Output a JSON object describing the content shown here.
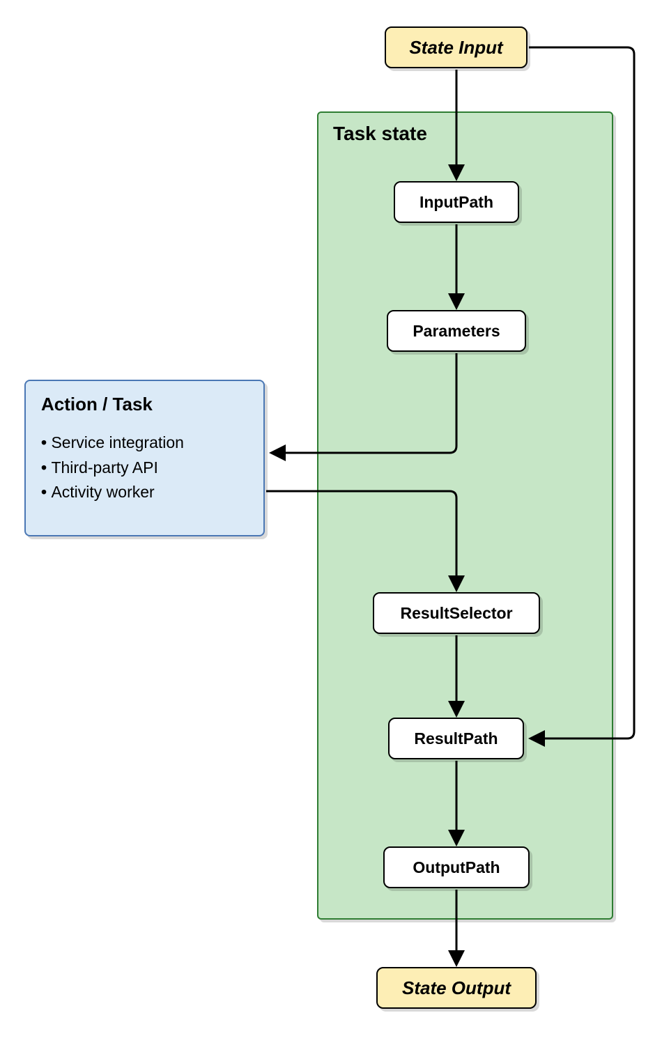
{
  "stateInput": {
    "label": "State Input"
  },
  "stateOutput": {
    "label": "State Output"
  },
  "taskState": {
    "title": "Task state",
    "nodes": {
      "inputPath": "InputPath",
      "parameters": "Parameters",
      "resultSelector": "ResultSelector",
      "resultPath": "ResultPath",
      "outputPath": "OutputPath"
    }
  },
  "actionTask": {
    "title": "Action / Task",
    "items": [
      "Service integration",
      "Third-party API",
      "Activity worker"
    ]
  },
  "colors": {
    "yellowFill": "#fdeeb5",
    "greenFill": "#c6e6c6",
    "greenStroke": "#2e7d32",
    "blueFill": "#dbeaf7",
    "blueStroke": "#4a77b4"
  }
}
